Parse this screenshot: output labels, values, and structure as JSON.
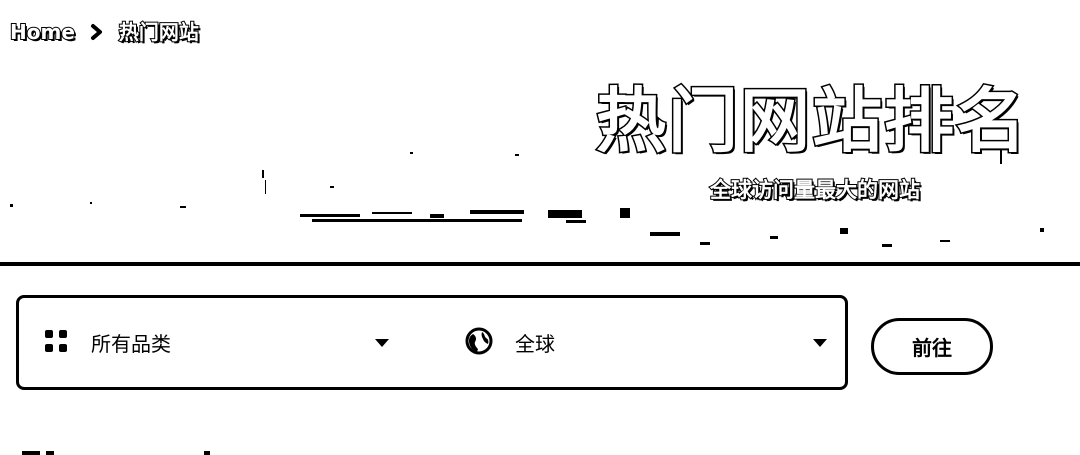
{
  "breadcrumb": {
    "home": "Home",
    "current": "热门网站"
  },
  "hero": {
    "title": "热门网站排名",
    "subtitle": "全球访问量最大的网站"
  },
  "filters": {
    "category": {
      "value": "所有品类",
      "icon": "grid-icon"
    },
    "region": {
      "value": "全球",
      "icon": "globe-icon"
    }
  },
  "actions": {
    "go_label": "前往"
  },
  "colors": {
    "foreground": "#000000",
    "background": "#ffffff"
  }
}
